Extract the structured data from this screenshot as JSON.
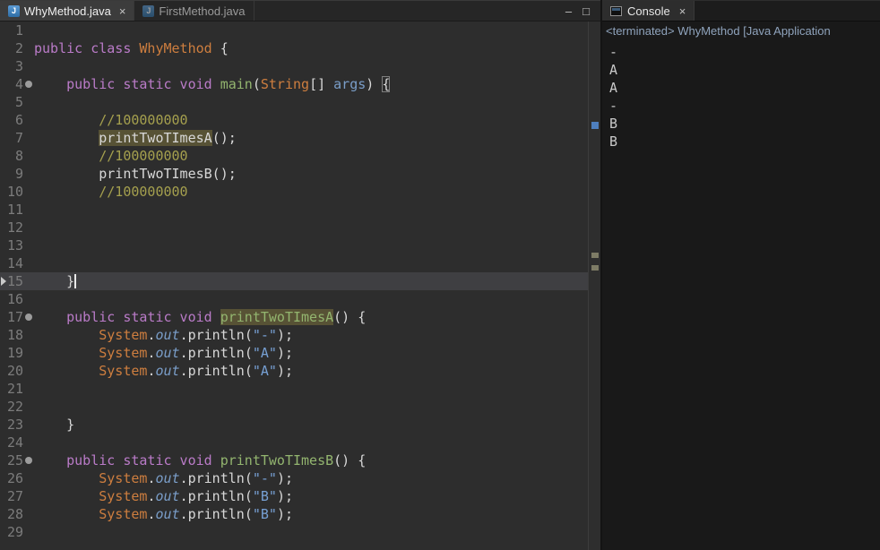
{
  "theme": {
    "editor_background": "#2d2d2d",
    "console_background": "#191919",
    "keyword_color": "#ba7bc8",
    "class_ref_color": "#ce7e3f",
    "method_decl_color": "#93b56f",
    "comment_color": "#a5a04e",
    "string_color": "#77a0d4",
    "occurrence_highlight": "#575235",
    "overview_mark_blue": "#4e7fbe"
  },
  "editor_tabs": [
    {
      "label": "WhyMethod.java",
      "close": "×",
      "active": true
    },
    {
      "label": "FirstMethod.java",
      "close": "",
      "active": false
    }
  ],
  "window_controls": {
    "minimize": "–",
    "maximize": "□"
  },
  "editor": {
    "current_line": 15,
    "fold_lines": [
      4,
      17,
      25
    ],
    "lines": [
      {
        "n": 1,
        "t": []
      },
      {
        "n": 2,
        "t": [
          [
            "public class ",
            "kw"
          ],
          [
            "WhyMethod",
            "cls"
          ],
          [
            " {",
            "pln"
          ]
        ]
      },
      {
        "n": 3,
        "t": []
      },
      {
        "n": 4,
        "t": [
          [
            "    ",
            "pln"
          ],
          [
            "public static void ",
            "kw"
          ],
          [
            "main",
            "mth"
          ],
          [
            "(",
            "pln"
          ],
          [
            "String",
            "cls"
          ],
          [
            "[] ",
            "pln"
          ],
          [
            "args",
            "var"
          ],
          [
            ") ",
            "pln"
          ],
          [
            "{",
            "brk"
          ]
        ]
      },
      {
        "n": 5,
        "t": []
      },
      {
        "n": 6,
        "t": [
          [
            "        ",
            "pln"
          ],
          [
            "//100000000",
            "cmt"
          ]
        ]
      },
      {
        "n": 7,
        "t": [
          [
            "        ",
            "pln"
          ],
          [
            "printTwoTImesA",
            "occ"
          ],
          [
            "();",
            "pln"
          ]
        ]
      },
      {
        "n": 8,
        "t": [
          [
            "        ",
            "pln"
          ],
          [
            "//100000000",
            "cmt"
          ]
        ]
      },
      {
        "n": 9,
        "t": [
          [
            "        ",
            "pln"
          ],
          [
            "printTwoTImesB();",
            "pln"
          ]
        ]
      },
      {
        "n": 10,
        "t": [
          [
            "        ",
            "pln"
          ],
          [
            "//100000000",
            "cmt"
          ]
        ]
      },
      {
        "n": 11,
        "t": []
      },
      {
        "n": 12,
        "t": []
      },
      {
        "n": 13,
        "t": []
      },
      {
        "n": 14,
        "t": []
      },
      {
        "n": 15,
        "t": [
          [
            "    }",
            "pln"
          ]
        ],
        "caret": true
      },
      {
        "n": 16,
        "t": []
      },
      {
        "n": 17,
        "t": [
          [
            "    ",
            "pln"
          ],
          [
            "public static void ",
            "kw"
          ],
          [
            "printTwoTImesA",
            "mocc"
          ],
          [
            "() {",
            "pln"
          ]
        ]
      },
      {
        "n": 18,
        "t": [
          [
            "        ",
            "pln"
          ],
          [
            "System",
            "cls"
          ],
          [
            ".",
            "pln"
          ],
          [
            "out",
            "fld"
          ],
          [
            ".",
            "pln"
          ],
          [
            "println",
            "pln"
          ],
          [
            "(",
            "pln"
          ],
          [
            "\"-\"",
            "str"
          ],
          [
            ");",
            "pln"
          ]
        ]
      },
      {
        "n": 19,
        "t": [
          [
            "        ",
            "pln"
          ],
          [
            "System",
            "cls"
          ],
          [
            ".",
            "pln"
          ],
          [
            "out",
            "fld"
          ],
          [
            ".",
            "pln"
          ],
          [
            "println",
            "pln"
          ],
          [
            "(",
            "pln"
          ],
          [
            "\"A\"",
            "str"
          ],
          [
            ");",
            "pln"
          ]
        ]
      },
      {
        "n": 20,
        "t": [
          [
            "        ",
            "pln"
          ],
          [
            "System",
            "cls"
          ],
          [
            ".",
            "pln"
          ],
          [
            "out",
            "fld"
          ],
          [
            ".",
            "pln"
          ],
          [
            "println",
            "pln"
          ],
          [
            "(",
            "pln"
          ],
          [
            "\"A\"",
            "str"
          ],
          [
            ");",
            "pln"
          ]
        ]
      },
      {
        "n": 21,
        "t": []
      },
      {
        "n": 22,
        "t": []
      },
      {
        "n": 23,
        "t": [
          [
            "    }",
            "pln"
          ]
        ]
      },
      {
        "n": 24,
        "t": []
      },
      {
        "n": 25,
        "t": [
          [
            "    ",
            "pln"
          ],
          [
            "public static void ",
            "kw"
          ],
          [
            "printTwoTImesB",
            "mth"
          ],
          [
            "() {",
            "pln"
          ]
        ]
      },
      {
        "n": 26,
        "t": [
          [
            "        ",
            "pln"
          ],
          [
            "System",
            "cls"
          ],
          [
            ".",
            "pln"
          ],
          [
            "out",
            "fld"
          ],
          [
            ".",
            "pln"
          ],
          [
            "println",
            "pln"
          ],
          [
            "(",
            "pln"
          ],
          [
            "\"-\"",
            "str"
          ],
          [
            ");",
            "pln"
          ]
        ]
      },
      {
        "n": 27,
        "t": [
          [
            "        ",
            "pln"
          ],
          [
            "System",
            "cls"
          ],
          [
            ".",
            "pln"
          ],
          [
            "out",
            "fld"
          ],
          [
            ".",
            "pln"
          ],
          [
            "println",
            "pln"
          ],
          [
            "(",
            "pln"
          ],
          [
            "\"B\"",
            "str"
          ],
          [
            ");",
            "pln"
          ]
        ]
      },
      {
        "n": 28,
        "t": [
          [
            "        ",
            "pln"
          ],
          [
            "System",
            "cls"
          ],
          [
            ".",
            "pln"
          ],
          [
            "out",
            "fld"
          ],
          [
            ".",
            "pln"
          ],
          [
            "println",
            "pln"
          ],
          [
            "(",
            "pln"
          ],
          [
            "\"B\"",
            "str"
          ],
          [
            ");",
            "pln"
          ]
        ]
      },
      {
        "n": 29,
        "t": []
      }
    ]
  },
  "console": {
    "tab_label": "Console",
    "close": "×",
    "title": "<terminated> WhyMethod [Java Application",
    "output": [
      "-",
      "A",
      "A",
      "-",
      "B",
      "B"
    ]
  }
}
